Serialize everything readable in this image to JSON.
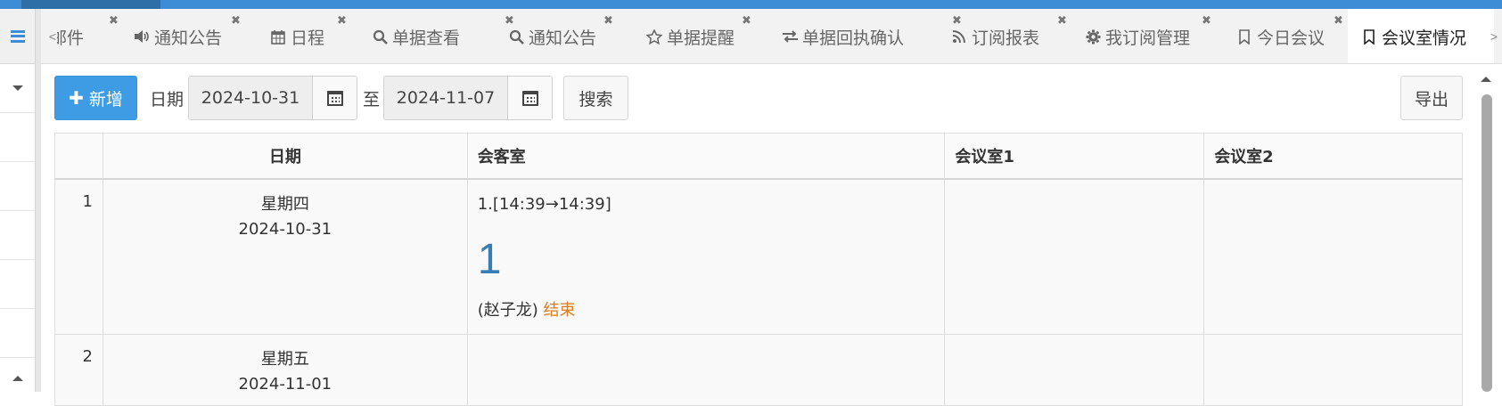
{
  "tabs": {
    "scroll_left": "<",
    "scroll_right": ">",
    "items": [
      {
        "label": "邮件",
        "icon": "",
        "active": false
      },
      {
        "label": "通知公告",
        "icon": "volume-icon",
        "active": false
      },
      {
        "label": "日程",
        "icon": "calendar-icon",
        "active": false
      },
      {
        "label": "单据查看",
        "icon": "search-icon",
        "active": false
      },
      {
        "label": "通知公告",
        "icon": "search-icon",
        "active": false
      },
      {
        "label": "单据提醒",
        "icon": "star-icon",
        "active": false
      },
      {
        "label": "单据回执确认",
        "icon": "exchange-icon",
        "active": false
      },
      {
        "label": "订阅报表",
        "icon": "rss-icon",
        "active": false
      },
      {
        "label": "我订阅管理",
        "icon": "gear-icon",
        "active": false
      },
      {
        "label": "今日会议",
        "icon": "bookmark-icon",
        "active": false
      },
      {
        "label": "会议室情况",
        "icon": "bookmark-icon",
        "active": true
      }
    ],
    "close_glyph": "✖"
  },
  "toolbar": {
    "add_label": "新增",
    "date_label": "日期",
    "date_from": "2024-10-31",
    "to_label": "至",
    "date_to": "2024-11-07",
    "search_label": "搜索",
    "export_label": "导出"
  },
  "table": {
    "headers": {
      "date": "日期",
      "room_a": "会客室",
      "room_b": "会议室1",
      "room_c": "会议室2"
    },
    "rows": [
      {
        "index": "1",
        "weekday": "星期四",
        "date": "2024-10-31",
        "booking": {
          "slot": "1.[14:39→14:39]",
          "count": "1",
          "person": "(赵子龙)",
          "status": "结束"
        }
      },
      {
        "index": "2",
        "weekday": "星期五",
        "date": "2024-11-01"
      }
    ]
  },
  "colors": {
    "primary": "#3e9ce4",
    "topbar": "#3c8dd6",
    "count": "#3a7cb5",
    "status_end": "#e07b1a"
  }
}
